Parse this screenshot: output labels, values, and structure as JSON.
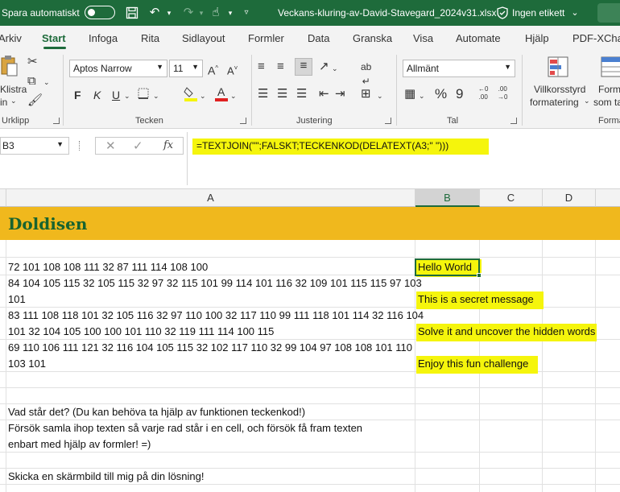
{
  "titlebar": {
    "autosave_label": "Spara automatiskt",
    "filename": "Veckans-kluring-av-David-Stavegard_2024v31.xlsx",
    "sensitivity_label": "Ingen etikett"
  },
  "tabs": [
    "Arkiv",
    "Start",
    "Infoga",
    "Rita",
    "Sidlayout",
    "Formler",
    "Data",
    "Granska",
    "Visa",
    "Automate",
    "Hjälp",
    "PDF-XCha"
  ],
  "ribbon": {
    "paste_label_1": "Klistra",
    "paste_label_2": "in",
    "font_name": "Aptos Narrow",
    "font_size": "11",
    "bold": "F",
    "italic": "K",
    "underline": "U",
    "number_format": "Allmänt",
    "cond_format_1": "Villkorsstyrd",
    "cond_format_2": "formatering",
    "format_table_1": "Form",
    "format_table_2": "som ta",
    "groups": {
      "clipboard": "Urklipp",
      "font": "Tecken",
      "alignment": "Justering",
      "number": "Tal",
      "styles": "Forma"
    }
  },
  "formula_bar": {
    "name_box": "B3",
    "formula": "=TEXTJOIN(\"\";FALSKT;TECKENKOD(DELATEXT(A3;\" \")))"
  },
  "columns": [
    "A",
    "B",
    "C",
    "D"
  ],
  "sheet": {
    "title": "Doldisen",
    "codes": [
      {
        "line1": "72 101 108 108 111 32 87 111 114 108 100",
        "line2": ""
      },
      {
        "line1": "84 104 105 115 32 105 115 32 97 32 115 101 99 114 101 116 32 109 101 115 115 97 103",
        "line2": "101"
      },
      {
        "line1": "83 111 108 118 101 32 105 116 32 97 110 100 32 117 110 99 111 118 101 114 32 116 104",
        "line2": "101 32 104 105 100 100 101 110 32 119 111 114 100 115"
      },
      {
        "line1": "69 110 106 111 121 32 116 104 105 115 32 102 117 110 32 99 104 97 108 108 101 110",
        "line2": "103 101"
      }
    ],
    "answers": [
      "Hello World",
      "This is a secret message",
      "Solve it and uncover the hidden words",
      "Enjoy this fun challenge"
    ],
    "question": "Vad står det? (Du kan behöva ta hjälp av funktionen teckenkod!)",
    "instruction_line1": "Försök samla ihop texten så varje rad står i en cell, och försök få fram texten",
    "instruction_line2": "enbart med hjälp av formler! =)",
    "footer": "Skicka en skärmbild till mig på din lösning!"
  },
  "colors": {
    "excel_green": "#1e6b3b",
    "title_band": "#f0b81d",
    "highlight": "#f5f50c"
  }
}
